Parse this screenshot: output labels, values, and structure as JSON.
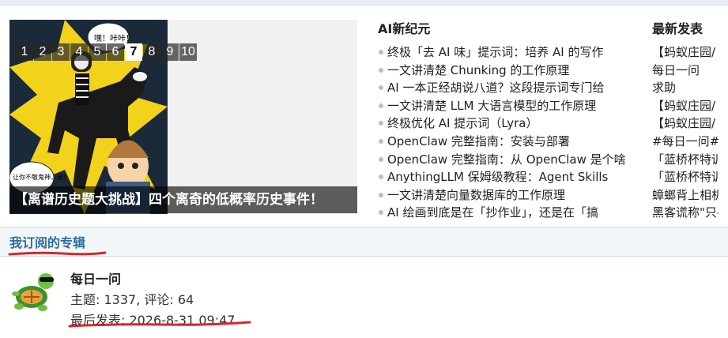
{
  "slider": {
    "pages": [
      "1",
      "2",
      "3",
      "4",
      "5",
      "6",
      "7",
      "8",
      "9",
      "10"
    ],
    "active_index": 6,
    "caption": "【离谱历史题大挑战】四个离奇的低概率历史事件！",
    "bubble_top": "嘿！咔咔！",
    "bubble_bottom": "让你不敬鬼神，该！"
  },
  "col1": {
    "title": "AI新纪元",
    "items": [
      "终极「去 AI 味」提示词：培养 AI 的写作",
      "一文讲清楚 Chunking 的工作原理",
      "AI 一本正经胡说八道？这段提示词专门给",
      "一文讲清楚 LLM 大语言模型的工作原理",
      "终极优化 AI 提示词（Lyra）",
      "OpenClaw 完整指南：安装与部署",
      "OpenClaw 完整指南：从 OpenClaw 是个啥",
      "AnythingLLM 保姆级教程：Agent Skills",
      "一文讲清楚向量数据库的工作原理",
      "AI 绘画到底是在「抄作业」，还是在「搞"
    ]
  },
  "col2": {
    "title": "最新发表",
    "items": [
      "【蚂蚁庄园/",
      "每日一问",
      "求助",
      "【蚂蚁庄园/",
      "【蚂蚁庄园/",
      "#每日一问#",
      "「蓝桥杯特训",
      "「蓝桥杯特训",
      "蟑螂背上相机",
      "黑客谎称\"只-"
    ]
  },
  "subscribed": {
    "title": "我订阅的专辑",
    "card": {
      "name": "每日一问",
      "meta": "主题: 1337, 评论: 64",
      "last_post": "最后发表: 2026-8-31 09:47"
    }
  }
}
